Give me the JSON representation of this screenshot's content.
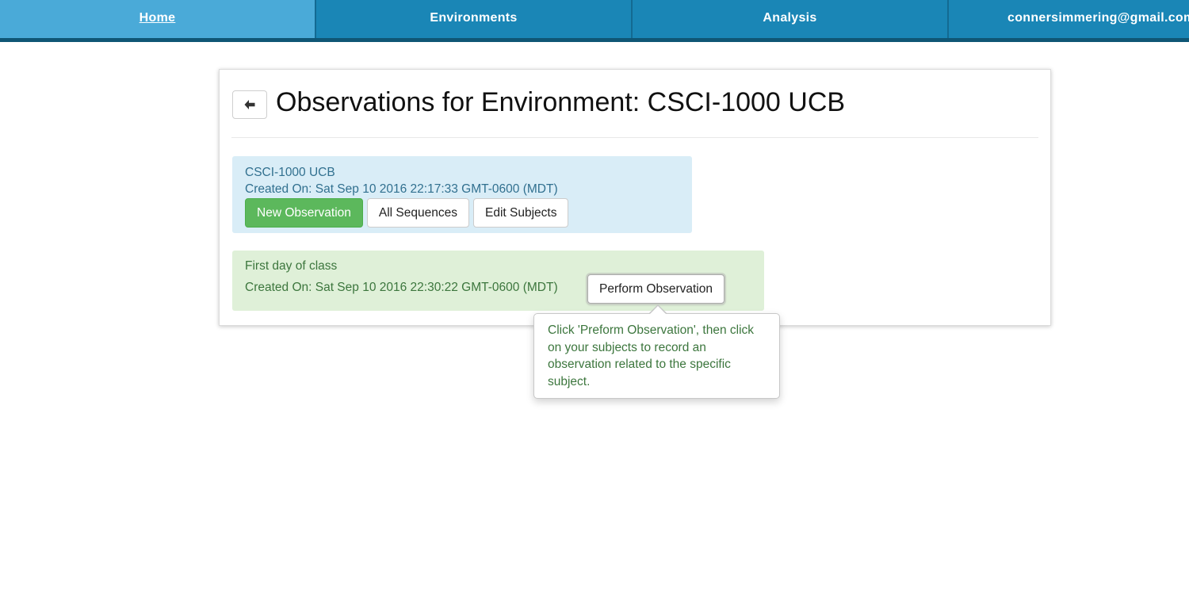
{
  "nav": {
    "items": [
      {
        "label": "Home"
      },
      {
        "label": "Environments"
      },
      {
        "label": "Analysis"
      }
    ],
    "user_email": "connersimmering@gmail.com"
  },
  "page": {
    "back_icon": "arrow-left-icon",
    "title": "Observations for Environment: CSCI-1000 UCB"
  },
  "environment": {
    "name": "CSCI-1000 UCB",
    "created": "Created On: Sat Sep 10 2016 22:17:33 GMT-0600 (MDT)",
    "buttons": {
      "new_observation": "New Observation",
      "all_sequences": "All Sequences",
      "edit_subjects": "Edit Subjects"
    }
  },
  "observation": {
    "name": "First day of class",
    "created": "Created On: Sat Sep 10 2016 22:30:22 GMT-0600 (MDT)",
    "perform_label": "Perform Observation"
  },
  "popover": {
    "text": "Click 'Preform Observation', then click on your subjects to record an observation related to the specific subject."
  },
  "colors": {
    "navbar": "#1a86b6",
    "nav_active": "#4aaad8",
    "info_bg": "#d9edf7",
    "info_text": "#31708f",
    "success_bg": "#dff0d8",
    "success_text": "#3c763d",
    "success_button": "#5cb85c"
  }
}
